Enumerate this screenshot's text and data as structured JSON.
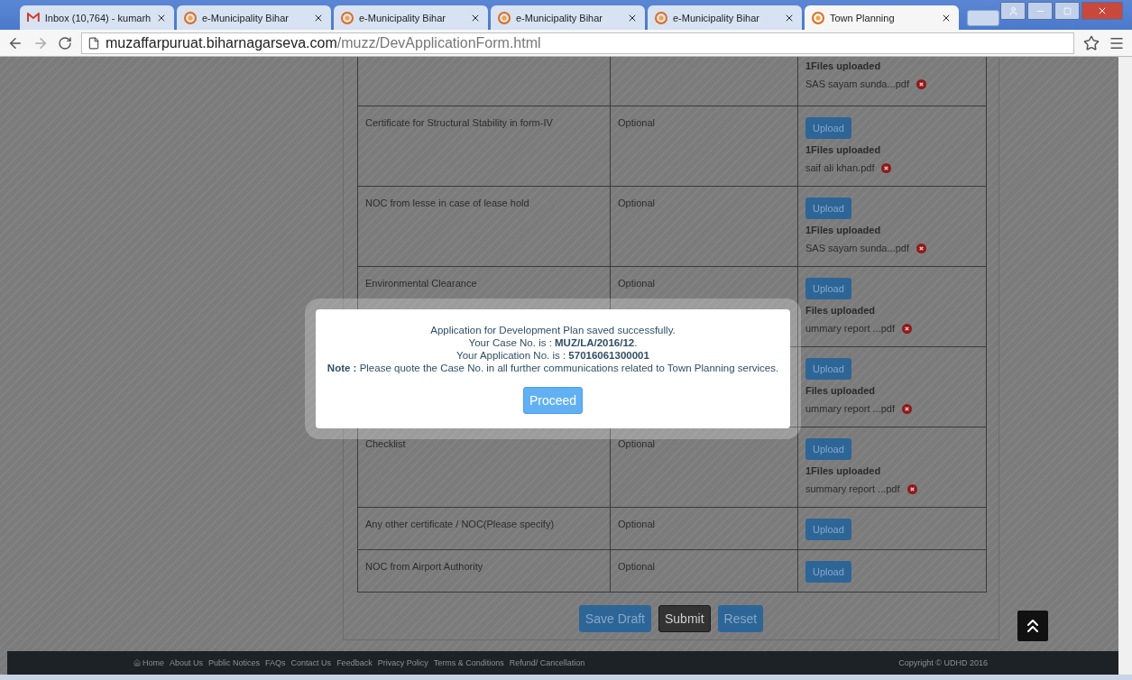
{
  "browser": {
    "tabs": [
      {
        "title": "Inbox (10,764) - kumarh",
        "kind": "mail",
        "selected": false
      },
      {
        "title": "e-Municipality Bihar",
        "kind": "site",
        "selected": false
      },
      {
        "title": "e-Municipality Bihar",
        "kind": "site",
        "selected": false
      },
      {
        "title": "e-Municipality Bihar",
        "kind": "site",
        "selected": false
      },
      {
        "title": "e-Municipality Bihar",
        "kind": "site",
        "selected": false
      },
      {
        "title": "Town Planning",
        "kind": "site",
        "selected": true
      }
    ],
    "url": {
      "host": "muzaffarpuruat.biharnagarseva.com",
      "path": "/muzz/DevApplicationForm.html"
    }
  },
  "documents": [
    {
      "status": "1Files uploaded",
      "file": "SAS sayam sunda...pdf"
    },
    {
      "document": "Certificate for Structural Stability in form-IV",
      "requirement": "Optional",
      "upload": "Upload",
      "status": "1Files uploaded",
      "file": "saif ali khan.pdf"
    },
    {
      "document": "NOC from lesse in case of lease hold",
      "requirement": "Optional",
      "upload": "Upload",
      "status": "1Files uploaded",
      "file": "SAS sayam sunda...pdf"
    },
    {
      "document": "Environmental Clearance",
      "requirement": "Optional",
      "upload": "Upload",
      "status": "Files uploaded",
      "file": "ummary report ...pdf"
    },
    {
      "upload": "Upload",
      "status": "Files uploaded",
      "file": "ummary report ...pdf"
    },
    {
      "document": "Checklist",
      "requirement": "Optional",
      "upload": "Upload",
      "status": "1Files uploaded",
      "file": "summary report ...pdf"
    },
    {
      "document": "Any other certificate / NOC(Please specify)",
      "requirement": "Optional",
      "upload": "Upload"
    },
    {
      "document": "NOC from Airport Authority",
      "requirement": "Optional",
      "upload": "Upload"
    }
  ],
  "actions": [
    {
      "label": "Save Draft",
      "kind": "primary"
    },
    {
      "label": "Submit",
      "kind": "dark"
    },
    {
      "label": "Reset",
      "kind": "primary"
    }
  ],
  "modal": {
    "lines": [
      "Application for Development Plan saved successfully.",
      "Your Case No. is : **MUZ/LA/2016/12**.",
      "Your Application No. is : **57016061300001**",
      "**Note :** Please quote the Case No. in all further communications related to Town Planning services."
    ],
    "button": "Proceed"
  },
  "footer": {
    "links": [
      "Home",
      "About Us",
      "Public Notices",
      "FAQs",
      "Contact Us",
      "Feedback",
      "Privacy Policy",
      "Terms & Conditions",
      "Refund/ Cancellation"
    ],
    "copyright": "Copyright © UDHD 2016"
  }
}
